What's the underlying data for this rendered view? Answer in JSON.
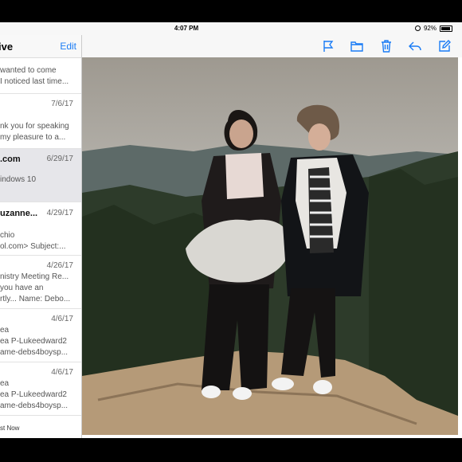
{
  "status": {
    "time": "4:07 PM",
    "battery": "92%"
  },
  "sidebar": {
    "title": "ive",
    "edit_label": "Edit",
    "items": [
      {
        "line1": "wanted to come",
        "line2": "I noticed last time..."
      },
      {
        "date": "7/6/17",
        "line1": "nk you for speaking",
        "line2": "my pleasure to a..."
      },
      {
        "sender": ".com",
        "date": "6/29/17",
        "line1": "indows 10"
      },
      {
        "sender": "uzanne...",
        "date": "4/29/17",
        "line1": "chio",
        "line2": "ol.com> Subject:..."
      },
      {
        "date": "4/26/17",
        "line1": "nistry Meeting Re...",
        "line2": "you have an",
        "line3": "rtly... Name: Debo..."
      },
      {
        "date": "4/6/17",
        "line1": "ea",
        "line2": "ea P-Lukeedward2",
        "line3": "ame-debs4boysp..."
      },
      {
        "date": "4/6/17",
        "line1": "ea",
        "line2": "ea P-Lukeedward2",
        "line3": "ame-debs4boysp..."
      }
    ],
    "footer": "st Now"
  },
  "toolbar": {
    "icons": [
      "flag-icon",
      "folder-icon",
      "trash-icon",
      "reply-icon",
      "compose-icon"
    ],
    "accent": "#1a7cf5"
  }
}
